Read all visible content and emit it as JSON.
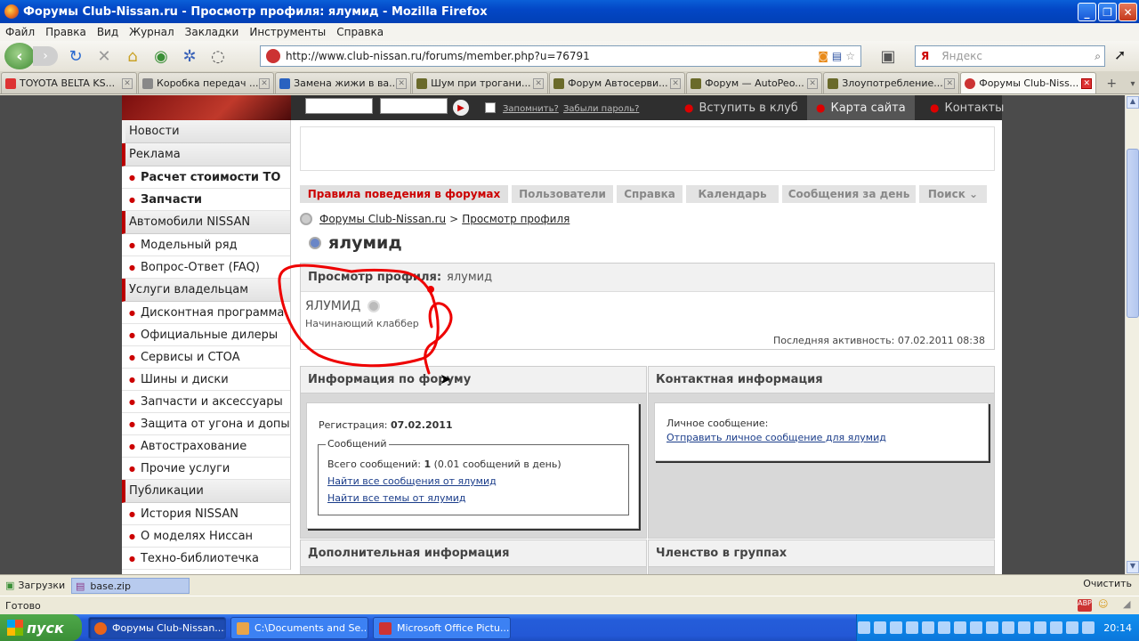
{
  "window": {
    "title": "Форумы Club-Nissan.ru - Просмотр профиля: ялумид - Mozilla Firefox"
  },
  "menu": [
    "Файл",
    "Правка",
    "Вид",
    "Журнал",
    "Закладки",
    "Инструменты",
    "Справка"
  ],
  "browser": {
    "url": "http://www.club-nissan.ru/forums/member.php?u=76791",
    "search_placeholder": "Яндекс",
    "search_engine": "Я"
  },
  "tabs": [
    {
      "label": "TOYOTA BELTA KS..."
    },
    {
      "label": "Коробка передач ..."
    },
    {
      "label": "Замена жижи в ва..."
    },
    {
      "label": "Шум при трогани..."
    },
    {
      "label": "Форум Автосерви..."
    },
    {
      "label": "Форум — AutoPeo..."
    },
    {
      "label": "Злоупотребление..."
    },
    {
      "label": "Форумы Club-Niss..."
    }
  ],
  "site": {
    "top": {
      "remember": "Запомнить?",
      "forgot": "Забыли пароль?",
      "join": "Вступить в клуб",
      "map": "Карта сайта",
      "contacts": "Контакты"
    },
    "sidebar": [
      {
        "label": "Новости",
        "kind": "head-plain"
      },
      {
        "label": "Реклама",
        "kind": "head"
      },
      {
        "label": "Расчет стоимости ТО",
        "kind": "item-bold"
      },
      {
        "label": "Запчасти",
        "kind": "item-bold"
      },
      {
        "label": "Автомобили NISSAN",
        "kind": "head"
      },
      {
        "label": "Модельный ряд",
        "kind": "item"
      },
      {
        "label": "Вопрос-Ответ (FAQ)",
        "kind": "item"
      },
      {
        "label": "Услуги владельцам",
        "kind": "head"
      },
      {
        "label": "Дисконтная программа",
        "kind": "item"
      },
      {
        "label": "Официальные дилеры",
        "kind": "item"
      },
      {
        "label": "Сервисы и СТОА",
        "kind": "item"
      },
      {
        "label": "Шины и диски",
        "kind": "item"
      },
      {
        "label": "Запчасти и аксессуары",
        "kind": "item"
      },
      {
        "label": "Защита от угона и допы",
        "kind": "item"
      },
      {
        "label": "Автострахование",
        "kind": "item"
      },
      {
        "label": "Прочие услуги",
        "kind": "item"
      },
      {
        "label": "Публикации",
        "kind": "head"
      },
      {
        "label": "История NISSAN",
        "kind": "item"
      },
      {
        "label": "О моделях Ниссан",
        "kind": "item"
      },
      {
        "label": "Техно-библиотечка",
        "kind": "item"
      }
    ],
    "navtabs": [
      "Правила поведения в форумах",
      "Пользователи",
      "Справка",
      "Календарь",
      "Сообщения за день",
      "Поиск"
    ],
    "breadcrumb": {
      "root": "Форумы Club-Nissan.ru",
      "sep": ">",
      "current": "Просмотр профиля"
    },
    "page_title": "ялумид",
    "profile": {
      "header": "Просмотр профиля:",
      "header_name": "ялумид",
      "username": "ЯЛУМИД",
      "rank": "Начинающий клаббер",
      "last_activity": "Последняя активность: 07.02.2011 08:38"
    },
    "forum_info": {
      "title": "Информация по форуму",
      "reg_label": "Регистрация:",
      "reg_date": "07.02.2011",
      "posts_legend": "Сообщений",
      "total_label": "Всего сообщений:",
      "total_count": "1",
      "per_day": "(0.01 сообщений в день)",
      "find_posts": "Найти все сообщения от ялумид",
      "find_threads": "Найти все темы от ялумид"
    },
    "contact": {
      "title": "Контактная информация",
      "pm_label": "Личное сообщение:",
      "pm_link": "Отправить личное сообщение для ялумид"
    },
    "extra": {
      "title": "Дополнительная информация"
    },
    "groups": {
      "title": "Членство в группах"
    }
  },
  "downloads": {
    "label": "Загрузки",
    "file": "base.zip",
    "clear": "Очистить"
  },
  "status": {
    "text": "Готово"
  },
  "taskbar": {
    "start": "пуск",
    "items": [
      "Форумы Club-Nissan....",
      "C:\\Documents and Se...",
      "Microsoft Office Pictu..."
    ],
    "time": "20:14"
  },
  "colors": {
    "accent": "#c00000",
    "xp_blue": "#245dda",
    "link": "#1b3d8a"
  }
}
